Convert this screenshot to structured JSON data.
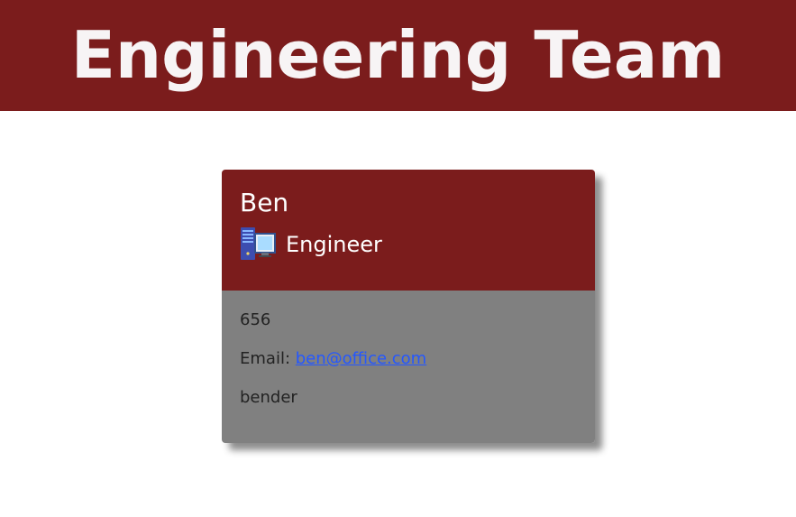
{
  "header": {
    "title": "Engineering Team",
    "background_color": "#7b1c1c"
  },
  "card": {
    "name": "Ben",
    "role": "Engineer",
    "role_icon": "computer-workstation-icon",
    "id": "656",
    "email_label": "Email:",
    "email": "ben@office.com",
    "username": "bender",
    "header_color": "#7b1c1c",
    "body_color": "#808080",
    "link_color": "#2457ff"
  }
}
